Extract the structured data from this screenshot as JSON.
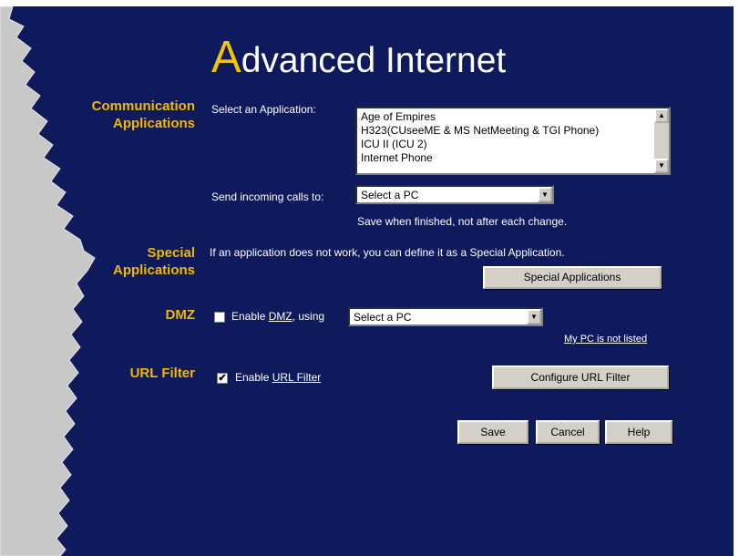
{
  "header": {
    "title_initial": "A",
    "title_rest": "dvanced Internet"
  },
  "communication": {
    "section_line1": "Communication",
    "section_line2": "Applications",
    "select_label": "Select an Application:",
    "applications": [
      "Age of Empires",
      "H323(CUseeME & MS NetMeeting & TGI Phone)",
      "ICU II (ICU 2)",
      "Internet Phone"
    ],
    "send_label": "Send incoming calls to:",
    "send_value": "Select a PC",
    "save_note": "Save when finished, not after each change."
  },
  "special": {
    "section_line1": "Special",
    "section_line2": "Applications",
    "description": "If an application does not work, you can define it as a Special Application.",
    "button_label": "Special Applications"
  },
  "dmz": {
    "section_label": "DMZ",
    "enable_prefix": "Enable ",
    "enable_link": "DMZ",
    "enable_suffix": ", using",
    "select_value": "Select a PC",
    "checked": false,
    "not_listed_link": "My PC is not listed"
  },
  "url_filter": {
    "section_label": "URL Filter",
    "enable_prefix": "Enable ",
    "enable_link": "URL Filter",
    "checked": true,
    "configure_button": "Configure URL Filter"
  },
  "actions": {
    "save": "Save",
    "cancel": "Cancel",
    "help": "Help"
  },
  "icons": {
    "scroll_up": "▲",
    "scroll_down": "▼",
    "dropdown": "▼",
    "check": "✔"
  },
  "colors": {
    "background": "#0e1a5c",
    "accent": "#f2b705",
    "title_initial": "#f5c20c",
    "torn_edge": "#c8c8c8"
  }
}
